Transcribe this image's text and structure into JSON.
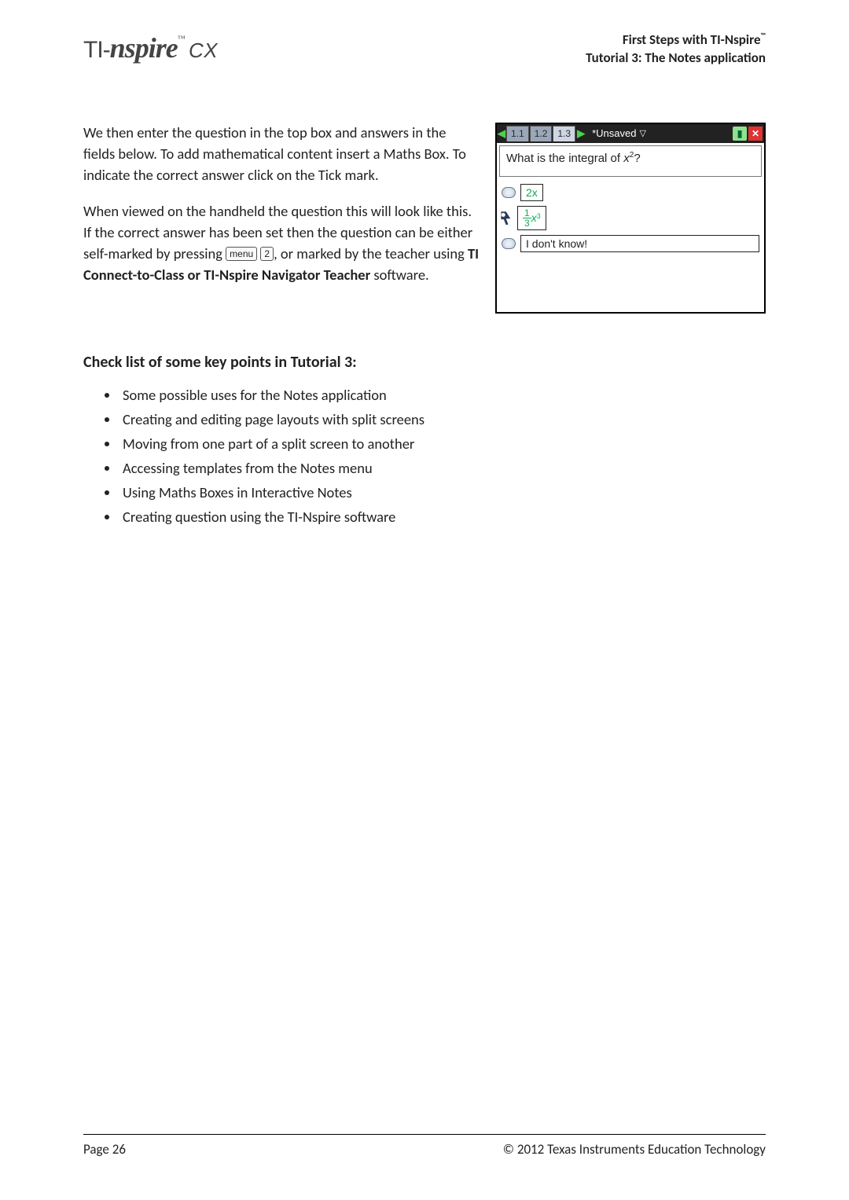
{
  "header": {
    "logo_tl": "TI-",
    "logo_nsp": "nspire",
    "logo_tm": "™",
    "logo_cx": "CX",
    "right_l1_a": "First Steps with TI-Nspire",
    "right_l1_tm": "™",
    "right_l2": "Tutorial 3: The Notes application"
  },
  "para1": "We then enter the question in the top box and answers in the fields below.  To add mathematical content insert a Maths Box.  To indicate the correct answer click on the Tick mark.",
  "para2a": "When viewed on the handheld the question this will look like this.  If the correct answer has been set then the question can be either self-marked by pressing ",
  "key_menu": "menu",
  "key_2": "2",
  "para2b": ", or marked by the teacher using ",
  "para2_bold": "TI Connect-to-Class or TI-Nspire Navigator Teacher",
  "para2c": " software.",
  "checklist_heading": "Check list of some key points in Tutorial 3:",
  "checklist": [
    "Some possible uses for the Notes application",
    "Creating and editing page layouts with split screens",
    "Moving from one part of a split screen to another",
    "Accessing templates from the Notes menu",
    "Using Maths Boxes in Interactive Notes",
    "Creating question using the TI-Nspire software"
  ],
  "calc": {
    "tabs": [
      "1.1",
      "1.2",
      "1.3"
    ],
    "title": "*Unsaved",
    "question_a": "What is the integral of ",
    "question_var": "x",
    "question_exp": "2",
    "question_b": "?",
    "ans1": "2x",
    "ans2_num": "1",
    "ans2_den": "3",
    "ans2_var": "x",
    "ans2_exp": "3",
    "ans3": "I don't know!"
  },
  "footer": {
    "left": "Page  26",
    "right": "© 2012 Texas Instruments Education Technology"
  }
}
